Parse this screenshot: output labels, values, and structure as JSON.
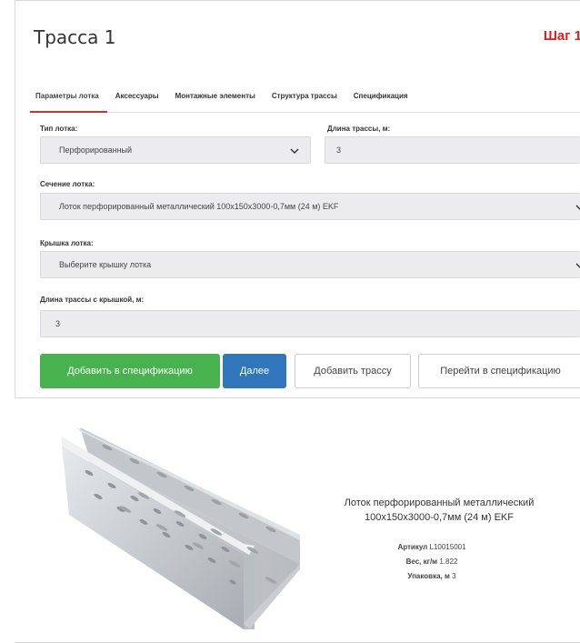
{
  "page_title": "Трасса 1",
  "step_label": "Шаг 1",
  "tabs": [
    {
      "label": "Параметры лотка",
      "active": true
    },
    {
      "label": "Аксессуары",
      "active": false
    },
    {
      "label": "Монтажные элементы",
      "active": false
    },
    {
      "label": "Структура трассы",
      "active": false
    },
    {
      "label": "Спецификация",
      "active": false
    }
  ],
  "form": {
    "tray_type": {
      "label": "Тип лотка:",
      "value": "Перфорированный"
    },
    "route_length": {
      "label": "Длина трассы, м:",
      "value": "3"
    },
    "tray_section": {
      "label": "Сечение лотка:",
      "value": "Лоток перфорированный металлический 100х150х3000-0,7мм (24 м) EKF"
    },
    "tray_cover": {
      "label": "Крышка лотка:",
      "value": "Выберите крышку лотка"
    },
    "covered_length": {
      "label": "Длина трассы с крышкой, м:",
      "value": "3"
    }
  },
  "buttons": {
    "add_to_spec": "Добавить в спецификацию",
    "next": "Далее",
    "add_route": "Добавить трассу",
    "go_to_spec": "Перейти в спецификацию"
  },
  "product": {
    "name_line1": "Лоток перфорированный металлический",
    "name_line2": "100х150х3000-0,7мм (24 м) EKF",
    "sku_label": "Артикул",
    "sku": "L10015001",
    "weight_label": "Вес, кг/м",
    "weight": "1.822",
    "pack_label": "Упаковка, м",
    "pack": "3"
  },
  "colors": {
    "accent_red": "#d9201f",
    "green_button": "#48b34e",
    "blue_button": "#3076bd",
    "field_bg": "#ececee"
  },
  "icons": [
    "chevron-down-icon",
    "cable-tray-image"
  ]
}
